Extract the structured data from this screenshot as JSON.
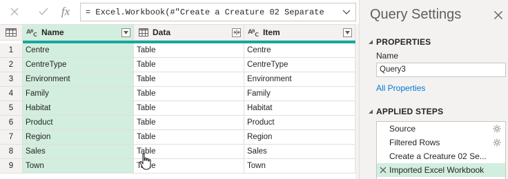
{
  "formula": "= Excel.Workbook(#\"Create a Creature 02 Separate",
  "grid": {
    "columns": [
      {
        "name": "Name",
        "type_icon": "text-type-icon"
      },
      {
        "name": "Data",
        "type_icon": "table-type-icon"
      },
      {
        "name": "Item",
        "type_icon": "text-type-icon"
      }
    ],
    "rows": [
      {
        "num": "1",
        "name": "Centre",
        "data": "Table",
        "item": "Centre"
      },
      {
        "num": "2",
        "name": "CentreType",
        "data": "Table",
        "item": "CentreType"
      },
      {
        "num": "3",
        "name": "Environment",
        "data": "Table",
        "item": "Environment"
      },
      {
        "num": "4",
        "name": "Family",
        "data": "Table",
        "item": "Family"
      },
      {
        "num": "5",
        "name": "Habitat",
        "data": "Table",
        "item": "Habitat"
      },
      {
        "num": "6",
        "name": "Product",
        "data": "Table",
        "item": "Product"
      },
      {
        "num": "7",
        "name": "Region",
        "data": "Table",
        "item": "Region"
      },
      {
        "num": "8",
        "name": "Sales",
        "data": "Table",
        "item": "Sales"
      },
      {
        "num": "9",
        "name": "Town",
        "data": "Table",
        "item": "Town"
      }
    ]
  },
  "query_settings": {
    "title": "Query Settings",
    "properties_heading": "PROPERTIES",
    "name_label": "Name",
    "name_value": "Query3",
    "all_properties": "All Properties",
    "applied_steps_heading": "APPLIED STEPS",
    "steps": [
      {
        "label": "Source",
        "has_gear": true,
        "selected": false
      },
      {
        "label": "Filtered Rows",
        "has_gear": true,
        "selected": false
      },
      {
        "label": "Create a Creature 02 Se...",
        "has_gear": false,
        "selected": false
      },
      {
        "label": "Imported Excel Workbook",
        "has_gear": false,
        "selected": true
      }
    ]
  },
  "colors": {
    "selected_column": "#d2eedf",
    "quality_bar": "#13a89e",
    "link": "#0078d4"
  }
}
